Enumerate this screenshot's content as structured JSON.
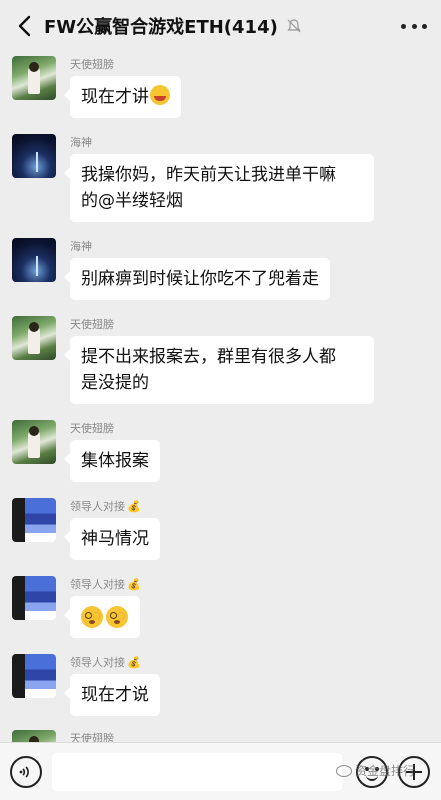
{
  "header": {
    "title": "FW公赢智合游戏ETH(414)",
    "back_icon": "chevron-left-icon",
    "mute_icon": "bell-off-icon",
    "more_icon": "more-dots-icon"
  },
  "messages": [
    {
      "sender": "天使翅膀",
      "avatar": "forest-portrait",
      "text": "现在才讲",
      "emoji": "grinning-sweat-face"
    },
    {
      "sender": "海神",
      "avatar": "night-sky",
      "line1": "我操你妈，昨天前天让我进单干嘛",
      "line2": "的@半缕轻烟"
    },
    {
      "sender": "海神",
      "avatar": "night-sky",
      "text": "别麻痹到时候让你吃不了兜着走"
    },
    {
      "sender": "天使翅膀",
      "avatar": "forest-portrait",
      "line1": "提不出来报案去，群里有很多人都",
      "line2": "是没提的"
    },
    {
      "sender": "天使翅膀",
      "avatar": "forest-portrait",
      "text": "集体报案"
    },
    {
      "sender": "领导人对接",
      "sender_badge": "money-bag-icon",
      "avatar": "pixelated",
      "text": "神马情况"
    },
    {
      "sender": "领导人对接",
      "sender_badge": "money-bag-icon",
      "avatar": "pixelated",
      "emoji": "dizzy-face",
      "emoji_count": 2
    },
    {
      "sender": "领导人对接",
      "sender_badge": "money-bag-icon",
      "avatar": "pixelated",
      "text": "现在才说"
    },
    {
      "sender": "天使翅膀",
      "avatar": "forest-portrait"
    }
  ],
  "composer": {
    "voice_icon": "voice-icon",
    "emoji_icon": "smiley-icon",
    "plus_icon": "plus-icon"
  },
  "watermark": {
    "text": "资金盘排行"
  },
  "colors": {
    "background": "#ededed",
    "bubble": "#ffffff",
    "name": "#8a8a8a"
  }
}
